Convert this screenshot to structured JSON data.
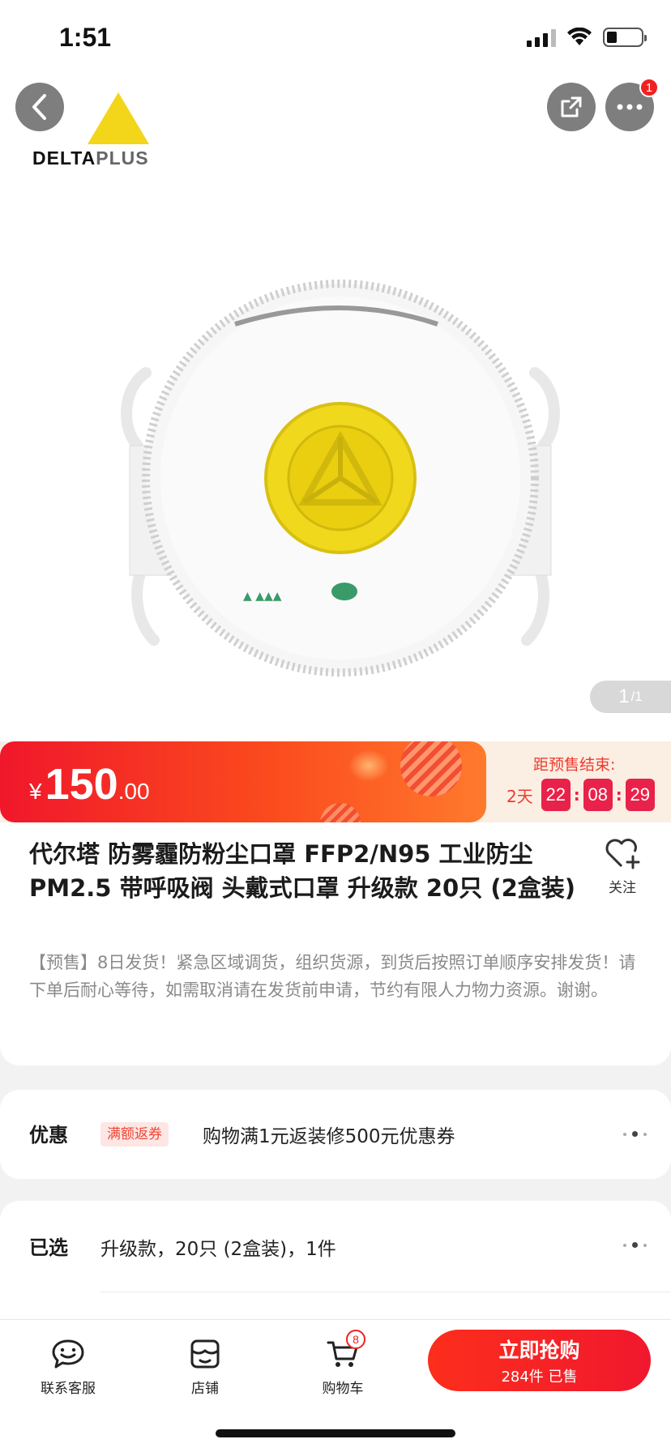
{
  "status_bar": {
    "time": "1:51",
    "battery_level": 0.25
  },
  "hero": {
    "brand_logo_delta": "DELTA",
    "brand_logo_plus": "PLUS",
    "page_current": "1",
    "page_total": "/1",
    "brand_color": "#f3d51a"
  },
  "price": {
    "currency": "¥",
    "integer": "150",
    "decimal": ".00"
  },
  "countdown": {
    "label": "距预售结束:",
    "days": "2天",
    "hours": "22",
    "minutes": "08",
    "seconds": "29"
  },
  "product": {
    "title": "代尔塔 防雾霾防粉尘口罩 FFP2/N95 工业防尘 PM2.5 带呼吸阀 头戴式口罩 升级款 20只 (2盒装)",
    "follow_label": "关注",
    "description": "【预售】8日发货！紧急区域调货，组织货源，到货后按照订单顺序安排发货！请下单后耐心等待，如需取消请在发货前申请，节约有限人力物力资源。谢谢。"
  },
  "coupon": {
    "label": "优惠",
    "tag": "满额返券",
    "text": "购物满1元返装修500元优惠券"
  },
  "selection": {
    "label": "已选",
    "text": "升级款，20只 (2盒装)，1件"
  },
  "bottom_bar": {
    "service_label": "联系客服",
    "store_label": "店铺",
    "cart_label": "购物车",
    "cart_count": "8",
    "buy_label": "立即抢购",
    "sold_text": "284件 已售",
    "more_badge": "1",
    "accent_color": "#f0182e"
  }
}
